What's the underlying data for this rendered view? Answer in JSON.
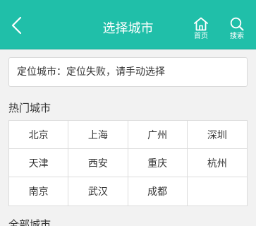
{
  "header": {
    "title": "选择城市",
    "home_label": "首页",
    "search_label": "搜索"
  },
  "location": {
    "label": "定位城市：",
    "status": "定位失败，请手动选择"
  },
  "hot_cities": {
    "title": "热门城市",
    "items": [
      "北京",
      "上海",
      "广州",
      "深圳",
      "天津",
      "西安",
      "重庆",
      "杭州",
      "南京",
      "武汉",
      "成都",
      ""
    ]
  },
  "all_cities": {
    "title": "全部城市"
  },
  "colors": {
    "header_bg": "#20bfa9"
  }
}
